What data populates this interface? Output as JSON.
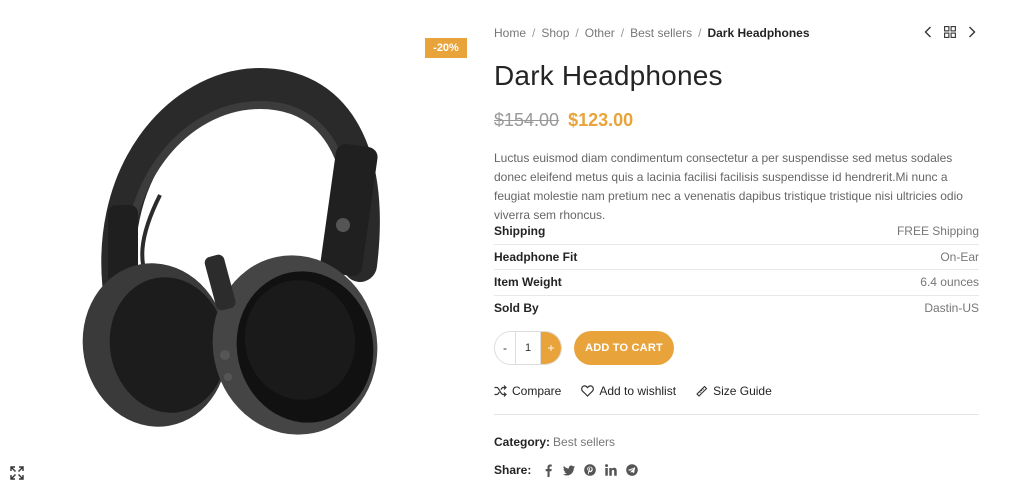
{
  "gallery": {
    "badge": "-20%",
    "image_icon": "headphones-image",
    "zoom_icon": "expand-icon"
  },
  "breadcrumb": {
    "items": [
      "Home",
      "Shop",
      "Other",
      "Best sellers"
    ],
    "separator": "/",
    "current": "Dark Headphones"
  },
  "nav": {
    "prev_icon": "chevron-left-icon",
    "grid_icon": "grid-icon",
    "next_icon": "chevron-right-icon"
  },
  "product": {
    "title": "Dark Headphones",
    "old_price": "$154.00",
    "new_price": "$123.00",
    "description": "Luctus euismod diam condimentum consectetur a per suspendisse sed metus sodales donec eleifend metus quis a lacinia facilisi facilisis suspendisse id hendrerit.Mi nunc a feugiat molestie nam pretium nec a venenatis dapibus tristique tristique nisi ultricies odio viverra sem rhoncus."
  },
  "attributes": [
    {
      "key": "Shipping",
      "value": "FREE Shipping"
    },
    {
      "key": "Headphone Fit",
      "value": "On-Ear"
    },
    {
      "key": "Item Weight",
      "value": "6.4 ounces"
    },
    {
      "key": "Sold By",
      "value": "Dastin-US"
    }
  ],
  "cart": {
    "minus": "-",
    "quantity": "1",
    "plus": "+",
    "add_label": "ADD TO CART"
  },
  "actions": {
    "compare": "Compare",
    "wishlist": "Add to wishlist",
    "size_guide": "Size Guide"
  },
  "meta": {
    "category_label": "Category:",
    "category_value": "Best sellers",
    "share_label": "Share:",
    "share_icons": [
      "facebook-icon",
      "twitter-icon",
      "pinterest-icon",
      "linkedin-icon",
      "telegram-icon"
    ]
  },
  "colors": {
    "accent": "#e8a33b",
    "text_dark": "#242424",
    "text_muted": "#777777"
  }
}
